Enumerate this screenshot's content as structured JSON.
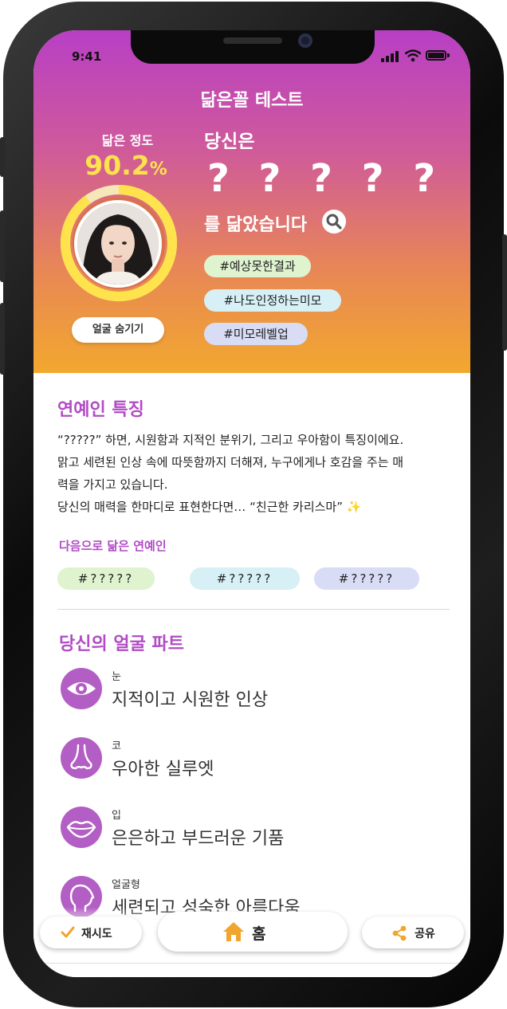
{
  "status_bar": {
    "time": "9:41"
  },
  "header": {
    "title": "닮은꼴 테스트"
  },
  "result": {
    "similarity_label": "닮은 정도",
    "similarity_number": "90.2",
    "similarity_unit": "%",
    "similarity_fraction": 0.902,
    "hide_face_label": "얼굴 숨기기",
    "you_are": "당신은",
    "celebrity_name": "? ? ? ? ?",
    "resemble_text": "를 닮았습니다",
    "tags": [
      "#예상못한결과",
      "#나도인정하는미모",
      "#미모레벨업"
    ]
  },
  "features": {
    "title": "연예인 특징",
    "lines": [
      "“?????” 하면, 시원함과 지적인 분위기, 그리고 우아함이 특징이에요.",
      " 맑고 세련된 인상 속에 따뜻함까지 더해져, 누구에게나 호감을 주는 매",
      "력을 가지고 있습니다.",
      "당신의 매력을 한마디로 표현한다면… “친근한 카리스마” ✨"
    ]
  },
  "next_similar": {
    "label": "다음으로 닮은 연예인",
    "chips": [
      "#?????",
      "#?????",
      "#?????"
    ]
  },
  "face_parts": {
    "title": "당신의 얼굴 파트",
    "items": [
      {
        "label": "눈",
        "desc": "지적이고 시원한 인상",
        "icon": "eye-icon"
      },
      {
        "label": "코",
        "desc": "우아한 실루엣",
        "icon": "nose-icon"
      },
      {
        "label": "입",
        "desc": "은은하고 부드러운 기품",
        "icon": "lips-icon"
      },
      {
        "label": "얼굴형",
        "desc": "세련되고 성숙한 아름다움",
        "icon": "face-shape-icon"
      }
    ]
  },
  "bottom_bar": {
    "retry": "재시도",
    "home": "홈",
    "share": "공유"
  },
  "colors": {
    "accent": "#b24bc5",
    "gold": "#ffe34d",
    "icon_bg": "#b35ec4"
  }
}
